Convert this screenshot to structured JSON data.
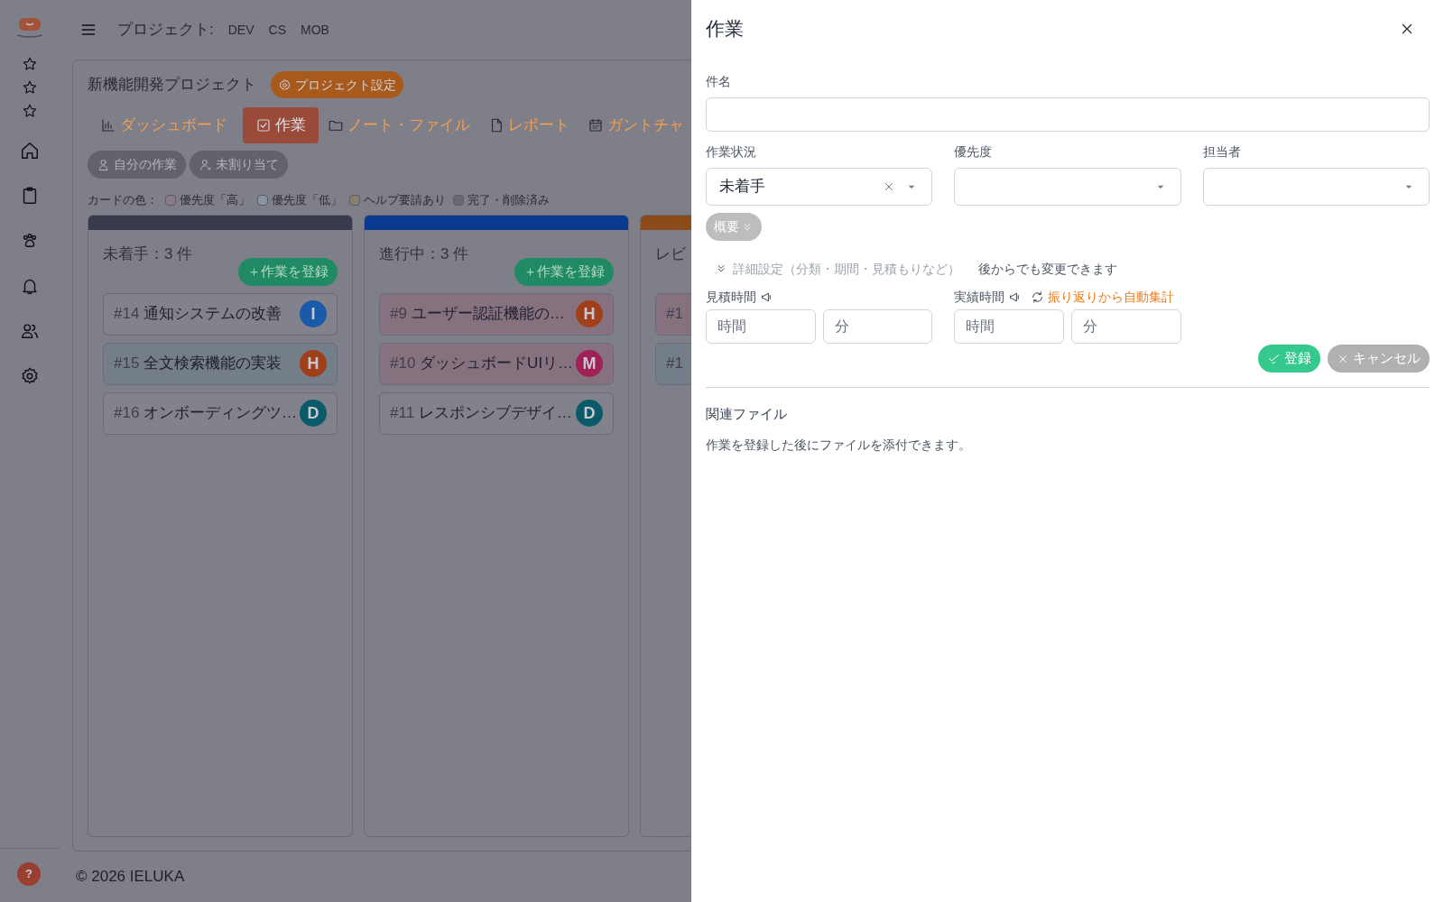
{
  "header": {
    "project_label": "プロジェクト:",
    "projects": [
      "DEV",
      "CS",
      "MOB"
    ]
  },
  "sidebar": {
    "help": "?"
  },
  "project": {
    "name": "新機能開発プロジェクト",
    "settings_button": "プロジェクト設定"
  },
  "tabs": [
    {
      "label": "ダッシュボード",
      "selected": false
    },
    {
      "label": "作業",
      "selected": true
    },
    {
      "label": "ノート・ファイル",
      "selected": false
    },
    {
      "label": "レポート",
      "selected": false
    },
    {
      "label": "ガントチャ",
      "selected": false
    }
  ],
  "filters": [
    {
      "label": "自分の作業"
    },
    {
      "label": "未割り当て"
    }
  ],
  "legend": {
    "label": "カードの色：",
    "items": [
      {
        "label": "優先度「高」",
        "color": "#8c7a84"
      },
      {
        "label": "優先度「低」",
        "color": "#8796a2"
      },
      {
        "label": "ヘルプ要請あり",
        "color": "#8a8070"
      },
      {
        "label": "完了・削除済み",
        "color": "#6a6a74"
      }
    ]
  },
  "columns": [
    {
      "title": "未着手：3 件",
      "color": "#363a4a",
      "add_button": "＋作業を登録",
      "cards": [
        {
          "number": "#14",
          "title": "通知システムの改善",
          "color": "#82828c",
          "avatar": {
            "initial": "I",
            "color": "#1a5aa8"
          }
        },
        {
          "number": "#15",
          "title": "全文検索機能の実装",
          "color": "#737e88",
          "avatar": {
            "initial": "H",
            "color": "#a0401a"
          }
        },
        {
          "number": "#16",
          "title": "オンボーディングツ…",
          "color": "#82828c",
          "avatar": {
            "initial": "D",
            "color": "#0a5a6a"
          }
        }
      ]
    },
    {
      "title": "進行中：3 件",
      "color": "#0a3a90",
      "add_button": "＋作業を登録",
      "cards": [
        {
          "number": "#9",
          "title": "ユーザー認証機能の…",
          "color": "#86727f",
          "avatar": {
            "initial": "H",
            "color": "#a0401a"
          }
        },
        {
          "number": "#10",
          "title": "ダッシュボードUIリ…",
          "color": "#86727f",
          "avatar": {
            "initial": "M",
            "color": "#a02058"
          }
        },
        {
          "number": "#11",
          "title": "レスポンシブデザイ…",
          "color": "#82828c",
          "avatar": {
            "initial": "D",
            "color": "#0a5a6a"
          }
        }
      ]
    },
    {
      "title": "レビ",
      "color": "#8a4a1a",
      "cards": [
        {
          "number": "#1",
          "color": "#86727f"
        },
        {
          "number": "#1",
          "color": "#737e88"
        }
      ]
    }
  ],
  "footer": "© 2026 IELUKA",
  "drawer": {
    "title": "作業",
    "name_label": "件名",
    "selects": [
      {
        "label": "作業状況",
        "value": "未着手",
        "clearable": true
      },
      {
        "label": "優先度",
        "clearable": false
      },
      {
        "label": "担当者",
        "clearable": false
      }
    ],
    "summary_toggle": "概要",
    "details_toggle": "詳細設定（分類・期間・見積もりなど）",
    "details_note": "後からでも変更できます",
    "estimate": {
      "label": "見積時間",
      "hours_placeholder": "時間",
      "minutes_placeholder": "分"
    },
    "actual": {
      "label": "実績時間",
      "auto_link": "振り返りから自動集計",
      "hours_placeholder": "時間",
      "minutes_placeholder": "分"
    },
    "submit_button": "登録",
    "cancel_button": "キャンセル",
    "files_heading": "関連ファイル",
    "files_note": "作業を登録した後にファイルを添付できます。"
  }
}
